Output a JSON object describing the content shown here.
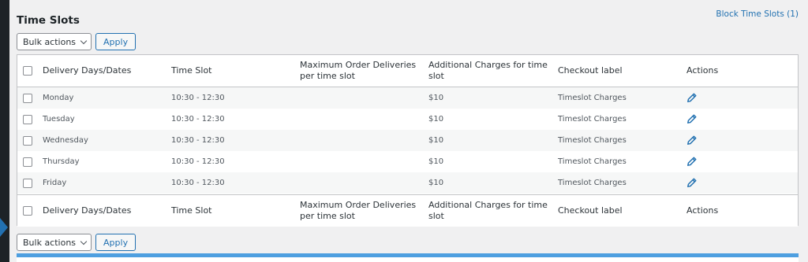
{
  "header": {
    "title": "Time Slots",
    "block_link": "Block Time Slots (1)"
  },
  "bulk": {
    "select_label": "Bulk actions",
    "apply_label": "Apply"
  },
  "columns": {
    "days": "Delivery Days/Dates",
    "time": "Time Slot",
    "max": "Maximum Order Deliveries per time slot",
    "charges": "Additional Charges for time slot",
    "label": "Checkout label",
    "actions": "Actions"
  },
  "rows": [
    {
      "day": "Monday",
      "time": "10:30 - 12:30",
      "max": "",
      "charge": "$10",
      "label": "Timeslot Charges"
    },
    {
      "day": "Tuesday",
      "time": "10:30 - 12:30",
      "max": "",
      "charge": "$10",
      "label": "Timeslot Charges"
    },
    {
      "day": "Wednesday",
      "time": "10:30 - 12:30",
      "max": "",
      "charge": "$10",
      "label": "Timeslot Charges"
    },
    {
      "day": "Thursday",
      "time": "10:30 - 12:30",
      "max": "",
      "charge": "$10",
      "label": "Timeslot Charges"
    },
    {
      "day": "Friday",
      "time": "10:30 - 12:30",
      "max": "",
      "charge": "$10",
      "label": "Timeslot Charges"
    }
  ],
  "icons": {
    "edit": "pencil-icon",
    "dropdown": "chevron-down-icon"
  },
  "colors": {
    "link": "#2271b1",
    "accent_bar": "#4e9fe0",
    "background": "#f0f0f1"
  }
}
